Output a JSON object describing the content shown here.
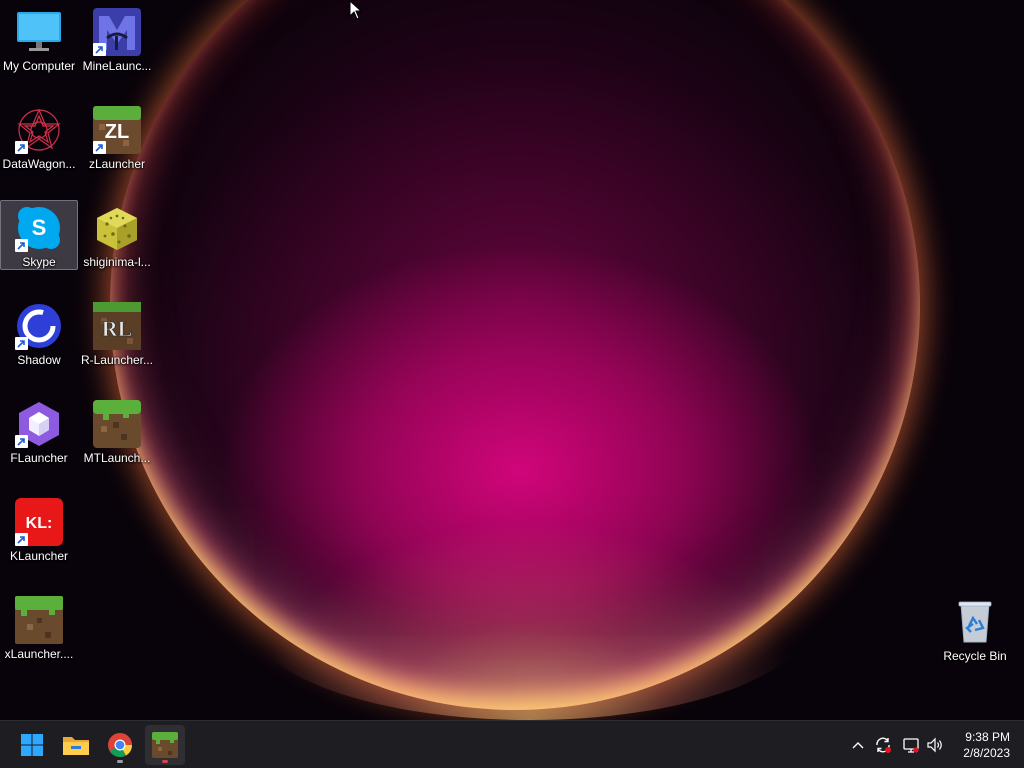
{
  "desktop_icons": [
    {
      "label": "My Computer",
      "icon": "monitor-icon",
      "shortcut": false
    },
    {
      "label": "MineLaunc...",
      "icon": "minelauncher-icon",
      "shortcut": true
    },
    {
      "label": "DataWagon...",
      "icon": "datawagon-icon",
      "shortcut": true
    },
    {
      "label": "zLauncher",
      "icon": "zlauncher-icon",
      "shortcut": true
    },
    {
      "label": "Skype",
      "icon": "skype-icon",
      "shortcut": true,
      "selected": true
    },
    {
      "label": "shiginima-l...",
      "icon": "shiginima-icon",
      "shortcut": false
    },
    {
      "label": "Shadow",
      "icon": "shadow-icon",
      "shortcut": true
    },
    {
      "label": "R-Launcher...",
      "icon": "rlauncher-icon",
      "shortcut": false
    },
    {
      "label": "FLauncher",
      "icon": "flauncher-icon",
      "shortcut": true
    },
    {
      "label": "MTLaunch...",
      "icon": "mtlauncher-icon",
      "shortcut": false
    },
    {
      "label": "KLauncher",
      "icon": "klauncher-icon",
      "shortcut": true
    },
    {
      "label": "xLauncher....",
      "icon": "xlauncher-icon",
      "shortcut": false
    },
    {
      "label": "Recycle Bin",
      "icon": "recycle-bin-icon",
      "shortcut": false
    }
  ],
  "icon_text": {
    "zlauncher": "ZL",
    "rlauncher": "RL",
    "klauncher": "KL:",
    "skype": "S"
  },
  "taskbar": {
    "pinned": [
      {
        "name": "start",
        "icon": "windows-start-icon"
      },
      {
        "name": "file-explorer",
        "icon": "folder-icon"
      },
      {
        "name": "chrome",
        "icon": "chrome-icon"
      },
      {
        "name": "minecraft-launcher",
        "icon": "grass-block-icon",
        "active": true
      }
    ],
    "tray_icons": [
      "chevron-up-icon",
      "sync-icon",
      "network-icon",
      "volume-icon"
    ],
    "time": "9:38 PM",
    "date": "2/8/2023"
  },
  "colors": {
    "taskbar_bg": "#1d1d22",
    "accent_blue": "#0a84ff",
    "wallpaper_magenta": "#d20078"
  }
}
